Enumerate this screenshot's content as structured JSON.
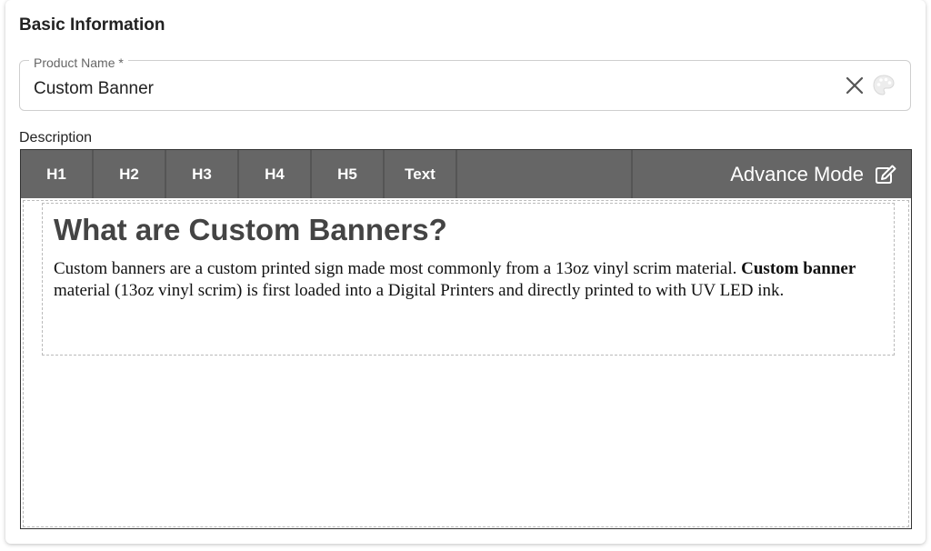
{
  "section": {
    "title": "Basic Information"
  },
  "product_name": {
    "label": "Product Name *",
    "value": "Custom Banner",
    "icons": [
      "close-icon",
      "palette-icon"
    ]
  },
  "description": {
    "label": "Description",
    "toolbar": {
      "buttons": [
        "H1",
        "H2",
        "H3",
        "H4",
        "H5",
        "Text"
      ],
      "advance_label": "Advance Mode",
      "advance_icon": "edit-icon"
    },
    "content": {
      "heading": "What are Custom Banners?",
      "paragraph_start": "Custom banners are a custom printed sign made most commonly from a 13oz vinyl scrim material. ",
      "paragraph_bold": "Custom banner",
      "paragraph_end": " material (13oz vinyl scrim) is first loaded into a Digital Printers and directly printed to with UV LED ink."
    }
  },
  "colors": {
    "toolbar_bg": "#666666",
    "toolbar_text": "#ffffff",
    "heading_text": "#444444"
  }
}
